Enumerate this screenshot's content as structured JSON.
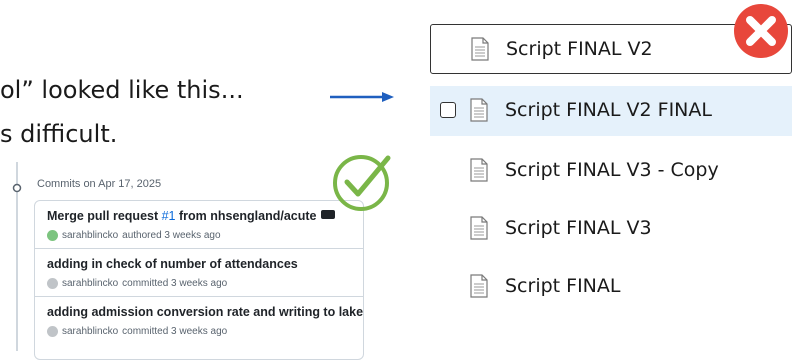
{
  "slide": {
    "line1": "ol” looked like this...",
    "line2": "s difficult."
  },
  "github": {
    "commits_date": "Commits on Apr 17, 2025",
    "commits": [
      {
        "title": "Merge pull request ",
        "pr": "#1",
        "title_rest": " from nhsengland/acute",
        "author": "sarahblincko",
        "action": "authored 3 weeks ago"
      },
      {
        "title": "adding in check of number of attendances",
        "author": "sarahblincko",
        "action": "committed 3 weeks ago"
      },
      {
        "title": "adding admission conversion rate and writing to lake",
        "author": "sarahblincko",
        "action": "committed 3 weeks ago"
      }
    ]
  },
  "files": [
    {
      "name": "Script FINAL V2",
      "state": "selected"
    },
    {
      "name": "Script FINAL V2 FINAL",
      "state": "hover"
    },
    {
      "name": "Script FINAL V3 - Copy",
      "state": "normal"
    },
    {
      "name": "Script FINAL V3",
      "state": "normal"
    },
    {
      "name": "Script FINAL",
      "state": "normal"
    }
  ],
  "colors": {
    "arrow": "#1f5fbf",
    "check": "#7ab648",
    "cross": "#e8473b",
    "hover_bg": "#e5f1fb",
    "link": "#0969da"
  },
  "icons": [
    "arrow-right-icon",
    "commit-node-icon",
    "checkmark-circle-icon",
    "close-x-icon",
    "document-icon"
  ]
}
